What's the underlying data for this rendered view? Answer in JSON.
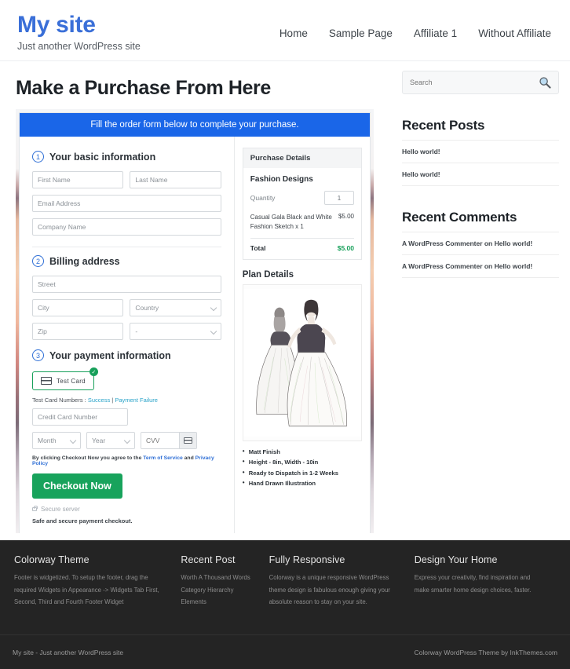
{
  "header": {
    "site_title": "My site",
    "tagline": "Just another WordPress site",
    "nav": [
      {
        "label": "Home"
      },
      {
        "label": "Sample Page"
      },
      {
        "label": "Affiliate 1"
      },
      {
        "label": "Without Affiliate"
      }
    ]
  },
  "main": {
    "page_title": "Make a Purchase From Here",
    "banner": "Fill the order form below to complete your purchase.",
    "step1": {
      "number": "1",
      "label": "Your basic information",
      "first_name_placeholder": "First Name",
      "last_name_placeholder": "Last Name",
      "email_placeholder": "Email Address",
      "company_placeholder": "Company Name"
    },
    "step2": {
      "number": "2",
      "label": "Billing address",
      "street_placeholder": "Street",
      "city_placeholder": "City",
      "country_value": "Country",
      "zip_placeholder": "Zip",
      "state_value": "-"
    },
    "step3": {
      "number": "3",
      "label": "Your payment information",
      "card_option": "Test  Card",
      "card_check_glyph": "✓",
      "test_card_prefix": "Test Card Numbers : ",
      "test_card_success": "Success",
      "test_card_separator": " | ",
      "test_card_failure": "Payment Failure",
      "cc_number_placeholder": "Credit Card Number",
      "month_value": "Month",
      "year_value": "Year",
      "cvv_placeholder": "CVV",
      "terms_prefix": "By clicking Checkout Now you agree to the ",
      "terms_link": "Term of Service",
      "terms_middle": " and ",
      "privacy_link": "Privacy Policy",
      "checkout_label": "Checkout Now",
      "secure_server": "Secure server",
      "safe_note": "Safe and secure payment checkout."
    },
    "purchase_details": {
      "head": "Purchase Details",
      "product": "Fashion Designs",
      "quantity_label": "Quantity",
      "quantity_value": "1",
      "item_name": "Casual Gala Black and White Fashion Sketch x 1",
      "item_price": "$5.00",
      "total_label": "Total",
      "total_value": "$5.00"
    },
    "plan_details": {
      "title": "Plan Details",
      "features": [
        "Matt Finish",
        "Height - 8in, Width - 10in",
        "Ready to Dispatch in 1-2 Weeks",
        "Hand Drawn Illustration"
      ]
    }
  },
  "sidebar": {
    "search_placeholder": "Search",
    "recent_posts_title": "Recent Posts",
    "recent_posts": [
      {
        "label": "Hello world!"
      },
      {
        "label": "Hello world!"
      }
    ],
    "recent_comments_title": "Recent Comments",
    "recent_comments": [
      {
        "label": "A WordPress Commenter on Hello world!"
      },
      {
        "label": "A WordPress Commenter on Hello world!"
      }
    ]
  },
  "footer": {
    "columns": [
      {
        "title": "Colorway Theme",
        "text": "Footer is widgetized. To setup the footer, drag the required Widgets in Appearance -> Widgets Tab First, Second, Third and Fourth Footer Widget"
      },
      {
        "title": "Recent Post",
        "items": [
          {
            "label": "Worth A Thousand Words"
          },
          {
            "label": "Category Hierarchy"
          },
          {
            "label": "Elements"
          }
        ]
      },
      {
        "title": "Fully Responsive",
        "text": "Colorway is a unique responsive WordPress theme design is fabulous enough giving your absolute reason to stay on your site."
      },
      {
        "title": "Design Your Home",
        "text": "Express your creativity, find inspiration and make smarter home design choices, faster."
      }
    ],
    "bottom_left": "My site - Just another WordPress site",
    "bottom_right": "Colorway WordPress Theme by InkThemes.com"
  },
  "colors": {
    "brand_blue": "#3a6fd8",
    "banner_blue": "#1a66e8",
    "accent_green": "#18a35c",
    "link_cyan": "#29a3c9",
    "footer_dark": "#242424"
  }
}
